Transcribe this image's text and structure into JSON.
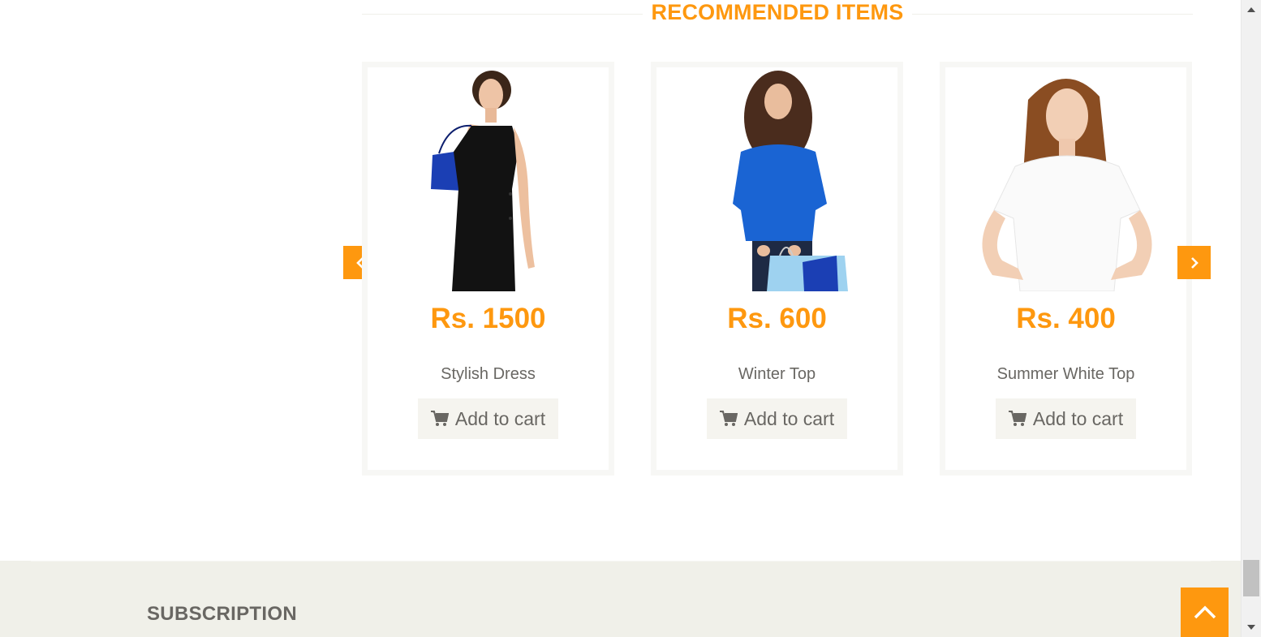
{
  "recommended": {
    "title": "RECOMMENDED ITEMS",
    "items": [
      {
        "price": "Rs. 1500",
        "name": "Stylish Dress",
        "button": "Add to cart"
      },
      {
        "price": "Rs. 600",
        "name": "Winter Top",
        "button": "Add to cart"
      },
      {
        "price": "Rs. 400",
        "name": "Summer White Top",
        "button": "Add to cart"
      }
    ]
  },
  "footer": {
    "subscription_title": "SUBSCRIPTION"
  },
  "icons": {
    "carousel_prev": "chevron-left-icon",
    "carousel_next": "chevron-right-icon",
    "cart": "shopping-cart-icon",
    "scroll_up": "chevron-up-icon"
  },
  "colors": {
    "accent": "#fe980f",
    "text": "#696763",
    "button_bg": "#f5f4ef",
    "footer_bg": "#f0f0e9"
  }
}
